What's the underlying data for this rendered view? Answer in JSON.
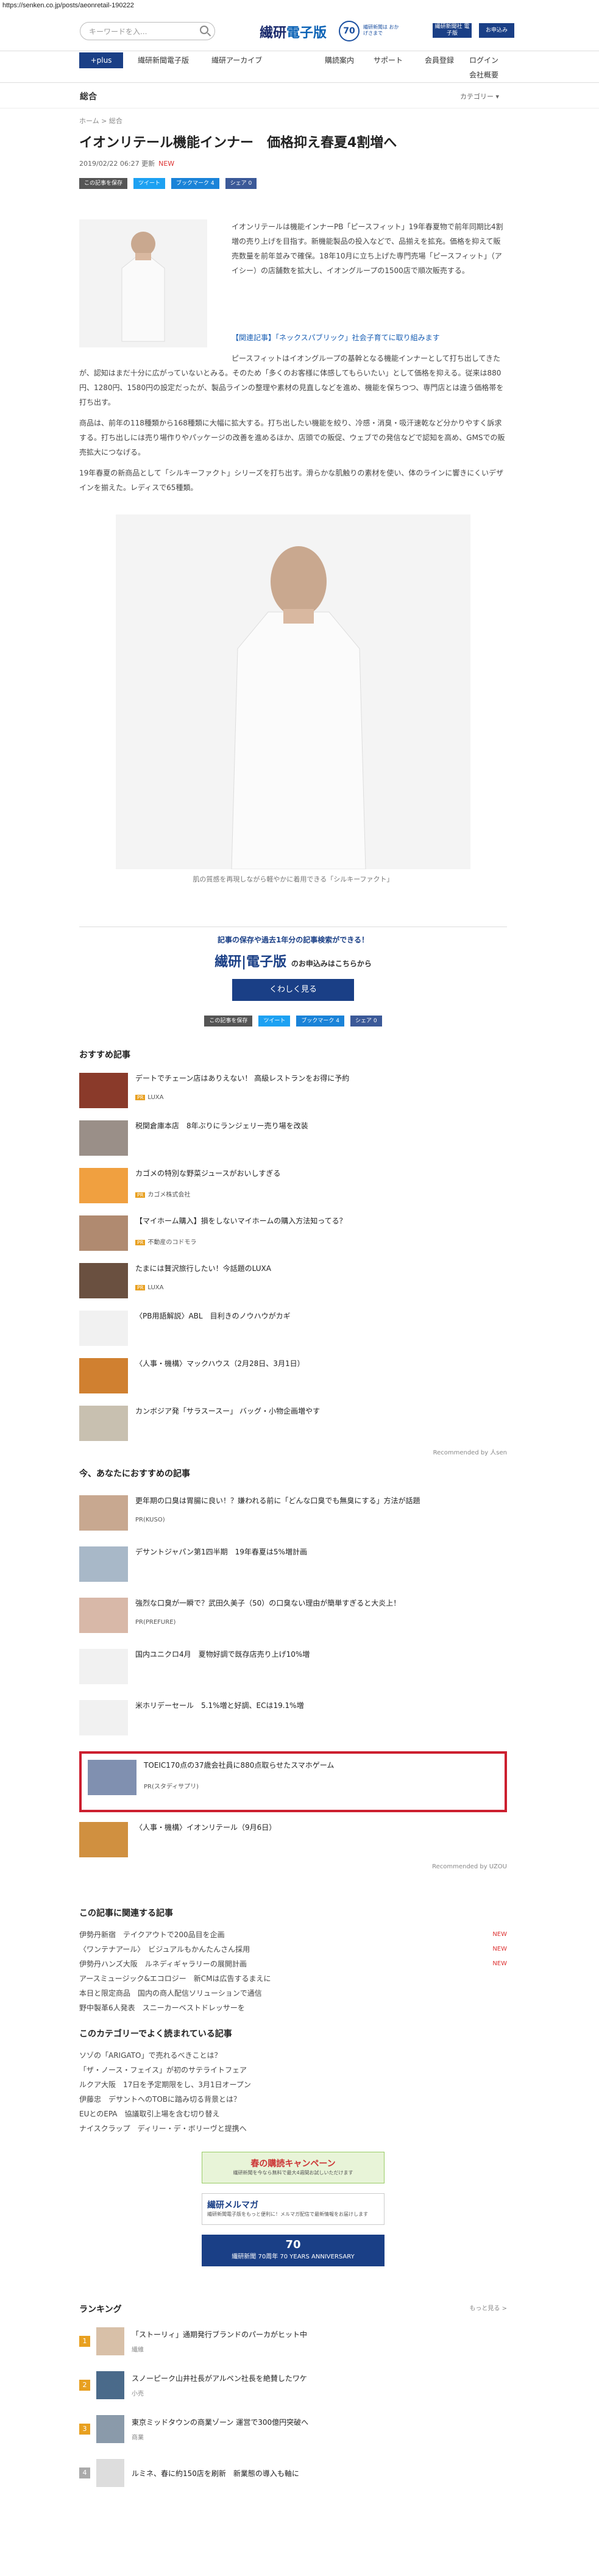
{
  "url": "https://senken.co.jp/posts/aeonretail-190222",
  "header": {
    "search_placeholder": "キーワードを入...",
    "logo_a": "繊研",
    "logo_b": "電子版",
    "logo_70": "70",
    "tag70": "繊研新聞は おかげさまで",
    "btn1": "繊研新聞社 電子版",
    "btn2": "お申込み"
  },
  "nav": {
    "plus": "+plus",
    "items": [
      "繊研新聞電子版",
      "繊研アーカイブ",
      "購読案内",
      "サポート",
      "会員登録",
      "ログイン",
      "会社概要"
    ]
  },
  "sub": {
    "left": "総合",
    "right": "カテゴリー ▾"
  },
  "article": {
    "crumb": "ホーム > 総合",
    "title": "イオンリテール機能インナー　価格抑え春夏4割増へ",
    "date": "2019/02/22 06:27 更新",
    "new": "NEW",
    "share": {
      "save": "この記事を保存",
      "tw": "ツイート",
      "hb": "ブックマーク 4",
      "fb": "シェア 0"
    },
    "p1": "イオンリテールは機能インナーPB「ピースフィット」19年春夏物で前年同期比4割増の売り上げを目指す。新機能製品の投入などで、品揃えを拡充。価格を抑えて販売数量を前年並みで確保。18年10月に立ち上げた専門売場「ピースフィット」（アイシー）の店舗数を拡大し、イオングループの1500店で順次販売する。",
    "p2": "【関連記事】「ネックスパブリック」社会子育てに取り組みます",
    "p3": "ピースフィットはイオングループの基幹となる機能インナーとして打ち出してきたが、認知はまだ十分に広がっていないとみる。そのため「多くのお客様に体感してもらいたい」として価格を抑える。従来は880円、1280円、1580円の設定だったが、製品ラインの整理や素材の見直しなどを進め、機能を保ちつつ、専門店とは違う価格帯を打ち出す。",
    "p4": "商品は、前年の118種類から168種類に大幅に拡大する。打ち出したい機能を絞り、冷感・消臭・吸汗速乾など分かりやすく訴求する。打ち出しには売り場作りやパッケージの改善を進めるほか、店頭での販促、ウェブでの発信などで認知を高め、GMSでの販売拡大につなげる。",
    "p5": "19年春夏の新商品として「シルキーファクト」シリーズを打ち出す。滑らかな肌触りの素材を使い、体のラインに響きにくいデザインを揃えた。レディスで65種類。",
    "caption": "肌の質感を再現しながら軽やかに着用できる「シルキーファクト」"
  },
  "promo": {
    "t1": "記事の保存や過去1年分の記事検索ができる！",
    "t2a": "繊研",
    "t2b": "電子版",
    "t2c": "のお申込みはこちらから",
    "btn": "くわしく見る"
  },
  "rec_title": "おすすめ記事",
  "rec": [
    {
      "title": "デートでチェーン店はありえない！ 高級レストランをお得に予約",
      "src": "LUXA",
      "pr": true
    },
    {
      "title": "税関倉庫本店　8年ぶりにランジェリー売り場を改装",
      "src": "",
      "pr": false
    },
    {
      "title": "カゴメの特別な野菜ジュースがおいしすぎる",
      "src": "カゴメ株式会社",
      "pr": true
    },
    {
      "title": "【マイホーム購入】損をしないマイホームの購入方法知ってる？",
      "src": "不動産のコドモラ",
      "pr": true
    },
    {
      "title": "たまには贅沢旅行したい！今話題のLUXA",
      "src": "LUXA",
      "pr": true
    },
    {
      "title": "〈PB用語解説〉ABL　目利きのノウハウがカギ",
      "src": "",
      "pr": false
    },
    {
      "title": "〈人事・機構〉マックハウス（2月28日、3月1日）",
      "src": "",
      "pr": false
    },
    {
      "title": "カンボジア発「サラスースー」 バッグ・小物企画増やす",
      "src": "",
      "pr": false
    }
  ],
  "rec_by": "Recommended by 人sen",
  "rec2_title": "今、あなたにおすすめの記事",
  "rec2": [
    {
      "title": "更年期の口臭は胃腸に良い！？嫌われる前に「どんな口臭でも無臭にする」方法が話題",
      "src": "PR(KUSO)"
    },
    {
      "title": "デサントジャパン第1四半期　19年春夏は5%増計画",
      "src": ""
    },
    {
      "title": "強烈な口臭が一瞬で？武田久美子（50）の口臭ない理由が簡単すぎると大炎上！",
      "src": "PR(PREFURE)"
    },
    {
      "title": "国内ユニクロ4月　夏物好調で既存店売り上げ10%増",
      "src": ""
    },
    {
      "title": "米ホリデーセール　5.1%増と好調、ECは19.1%増",
      "src": ""
    },
    {
      "title": "TOEIC170点の37歳会社員に880点取らせたスマホゲーム",
      "src": "PR(スタディサプリ)"
    },
    {
      "title": "〈人事・機構〉イオンリテール（9月6日）",
      "src": ""
    }
  ],
  "rec2_by": "Recommended by UZOU",
  "related_title": "この記事に関連する記事",
  "related": [
    {
      "t": "伊勢丹新宿　テイクアウトで200品目を企画",
      "n": "NEW"
    },
    {
      "t": "〈ワンテナアール〉　ビジュアルもかんたんさん採用",
      "n": "NEW"
    },
    {
      "t": "伊勢丹ハンズ大阪　ルネディギャラリーの展開計画",
      "n": "NEW"
    },
    {
      "t": "アースミュージック&エコロジー　新CMは広告するまえに",
      "n": ""
    },
    {
      "t": "本日と限定商品　国内の商人配信ソリューションで通信",
      "n": ""
    },
    {
      "t": "野中製革6人発表　スニーカーベストドレッサーを",
      "n": ""
    }
  ],
  "popular_title": "このカテゴリーでよく読まれている記事",
  "popular": [
    "ソゾの「ARIGATO」で売れるべきことは？",
    "「ザ・ノース・フェイス」が初のサテライトフェア",
    "ルクア大阪　17日を予定期限をし、3月1日オープン",
    "伊藤忠　デサントへのTOBに踏み切る背景とは？",
    "EUとのEPA　協議取引上場を含む切り替え",
    "ナイスクラップ　ディリー・デ・ボリーヴと提携へ"
  ],
  "banners": [
    {
      "a": "春の購読キャンペーン",
      "b": "繊研新聞を今なら無料で最大4週間お試しいただけます"
    },
    {
      "a": "繊研メルマガ",
      "b": "繊研新聞電子版をもっと便利に！メルマガ配信で最新情報をお届けします"
    },
    {
      "a": "70",
      "b": "繊研新聞 70周年 70 YEARS ANNIVERSARY"
    }
  ],
  "ranking_title": "ランキング",
  "ranking_more": "もっと見る >",
  "ranking": [
    {
      "n": "1",
      "t": "「ストーリィ」通期発行ブランドのパーカがヒット中",
      "s": "繊維"
    },
    {
      "n": "2",
      "t": "スノーピーク山井社長がアルペン社長を絶賛したワケ",
      "s": "小売"
    },
    {
      "n": "3",
      "t": "東京ミッドタウンの商業ゾーン 運営で300億円突破へ",
      "s": "商業"
    },
    {
      "n": "4",
      "t": "ルミネ、春に約150店を刷新　新業態の導入も軸に",
      "s": ""
    }
  ]
}
